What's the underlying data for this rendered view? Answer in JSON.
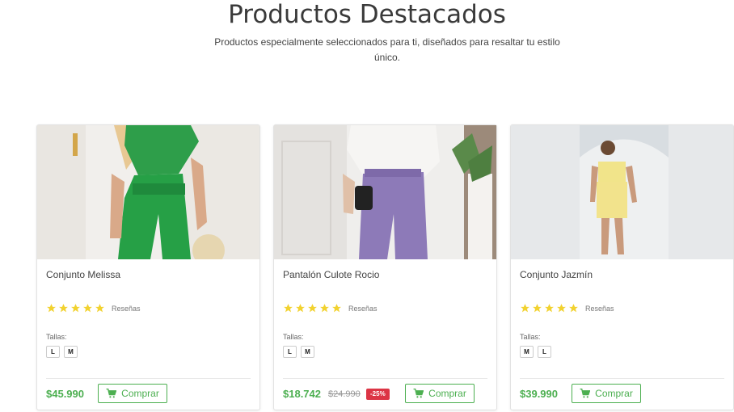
{
  "section": {
    "title": "Productos Destacados",
    "subtitle": "Productos especialmente seleccionados para ti, diseñados para resaltar tu estilo único."
  },
  "products": [
    {
      "name": "Conjunto Melissa",
      "rating": 5,
      "reviews_label": "Reseñas",
      "sizes_label": "Tallas:",
      "sizes": [
        "L",
        "M"
      ],
      "price": "$45.990",
      "old_price": "",
      "discount": "",
      "buy_label": "Comprar",
      "image": "green-two-piece-outfit"
    },
    {
      "name": "Pantalón Culote Rocio",
      "rating": 5,
      "reviews_label": "Reseñas",
      "sizes_label": "Tallas:",
      "sizes": [
        "L",
        "M"
      ],
      "price": "$18.742",
      "old_price": "$24.990",
      "discount": "-25%",
      "buy_label": "Comprar",
      "image": "purple-culotte-pants"
    },
    {
      "name": "Conjunto Jazmín",
      "rating": 5,
      "reviews_label": "Reseñas",
      "sizes_label": "Tallas:",
      "sizes": [
        "M",
        "L"
      ],
      "price": "$39.990",
      "old_price": "",
      "discount": "",
      "buy_label": "Comprar",
      "image": "yellow-two-piece-outfit"
    }
  ],
  "colors": {
    "accent": "#4caf50",
    "star": "#f2d230",
    "discount": "#dc3545"
  },
  "icons": {
    "star": "star-icon",
    "cart": "cart-icon"
  }
}
